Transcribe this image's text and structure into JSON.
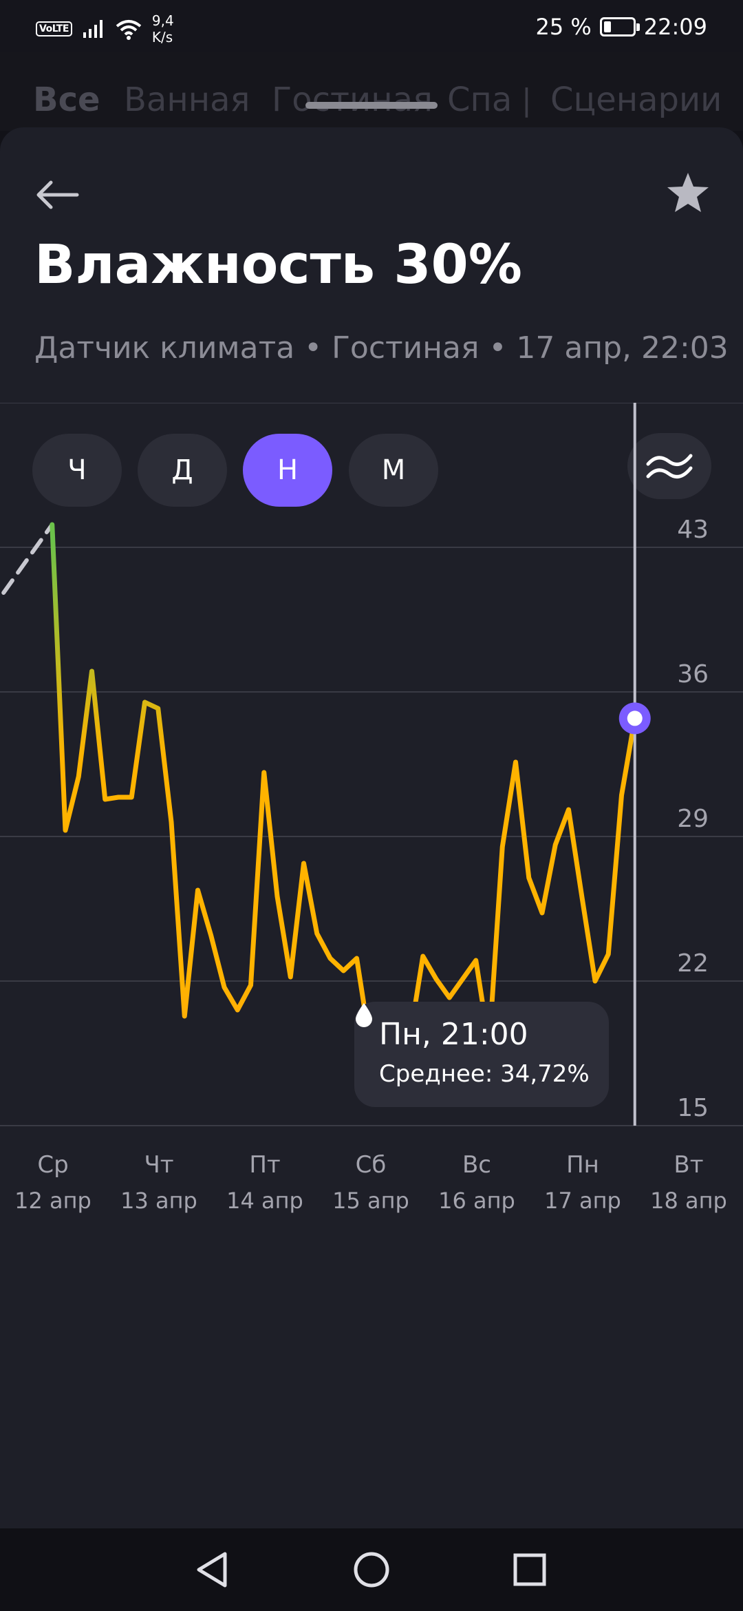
{
  "status_bar": {
    "volte": "VoLTE",
    "net_speed_value": "9,4",
    "net_speed_unit": "K/s",
    "battery_percent": "25 %",
    "battery_level": 0.25,
    "time": "22:09"
  },
  "background_tabs": [
    "Все",
    "Ванная",
    "Гостиная",
    "Спа",
    "Сценарии"
  ],
  "header": {
    "back_icon": "arrow-left-icon",
    "favorite_icon": "star-icon",
    "title": "Влажность 30%",
    "subtitle": "Датчик климата • Гостиная • 17 апр, 22:03"
  },
  "periods": {
    "items": [
      "Ч",
      "Д",
      "Н",
      "М"
    ],
    "selected": "Н",
    "compare_icon": "wave-lines-icon"
  },
  "colors": {
    "accent": "#7B5CFF",
    "line": "#FFB300",
    "line_low": "#FF9F1A",
    "line_start": "#6CC24A",
    "sheet_bg": "#1E1F28"
  },
  "tooltip": {
    "icon": "drop-icon",
    "time": "Пн, 21:00",
    "average": "Среднее: 34,72%"
  },
  "chart_data": {
    "type": "line",
    "y_ticks": [
      "43",
      "36",
      "29",
      "22",
      "15"
    ],
    "ylim": [
      15,
      50
    ],
    "x_days": [
      {
        "weekday": "Ср",
        "date": "12 апр"
      },
      {
        "weekday": "Чт",
        "date": "13 апр"
      },
      {
        "weekday": "Пт",
        "date": "14 апр"
      },
      {
        "weekday": "Сб",
        "date": "15 апр"
      },
      {
        "weekday": "Вс",
        "date": "16 апр"
      },
      {
        "weekday": "Пн",
        "date": "17 апр"
      },
      {
        "weekday": "Вт",
        "date": "18 апр"
      }
    ],
    "day_start": [
      "12 апр 00:00",
      "13 апр 00:00",
      "14 апр 00:00",
      "15 апр 00:00",
      "16 апр 00:00",
      "17 апр 00:00",
      "18 апр 00:00"
    ],
    "dashed_series": {
      "x": [
        "11 апр 22:00",
        "12 апр 09:00"
      ],
      "y": [
        40.8,
        44.1
      ]
    },
    "series": [
      {
        "x": [
          "12 апр 09:00",
          "12 апр 12:00",
          "12 апр 15:00",
          "12 апр 18:00",
          "12 апр 21:00",
          "13 апр 00:00",
          "13 апр 03:00",
          "13 апр 06:00",
          "13 апр 09:00",
          "13 апр 12:00",
          "13 апр 15:00",
          "13 апр 18:00",
          "13 апр 21:00",
          "14 апр 00:00",
          "14 апр 03:00",
          "14 апр 06:00",
          "14 апр 09:00",
          "14 апр 12:00",
          "14 апр 15:00",
          "14 апр 18:00",
          "14 апр 21:00",
          "15 апр 00:00",
          "15 апр 03:00",
          "15 апр 06:00",
          "15 апр 09:00",
          "15 апр 12:00",
          "15 апр 15:00",
          "15 апр 18:00",
          "15 апр 21:00",
          "16 апр 00:00",
          "16 апр 03:00",
          "16 апр 06:00",
          "16 апр 09:00",
          "16 апр 12:00",
          "16 апр 15:00",
          "16 апр 18:00",
          "16 апр 21:00",
          "17 апр 00:00",
          "17 апр 03:00",
          "17 апр 06:00",
          "17 апр 09:00",
          "17 апр 12:00",
          "17 апр 15:00",
          "17 апр 18:00",
          "17 апр 21:00"
        ],
        "y": [
          44.1,
          29.3,
          31.9,
          37.0,
          30.8,
          30.9,
          30.9,
          35.5,
          35.2,
          29.7,
          20.3,
          26.4,
          24.2,
          21.7,
          20.6,
          21.8,
          32.1,
          26.1,
          22.2,
          27.7,
          24.3,
          23.1,
          22.5,
          23.1,
          19.0,
          19.5,
          19.6,
          19.2,
          23.2,
          22.1,
          21.2,
          22.1,
          23.0,
          18.9,
          28.5,
          32.6,
          27.0,
          25.3,
          28.6,
          30.3,
          26.1,
          22.0,
          23.3,
          31.0,
          34.72
        ]
      }
    ],
    "selected_point": {
      "x": "17 апр 21:00",
      "y": 34.72
    },
    "grid": true
  },
  "nav_bar": {
    "back_icon": "triangle-back-icon",
    "home_icon": "circle-home-icon",
    "recents_icon": "square-recents-icon"
  }
}
